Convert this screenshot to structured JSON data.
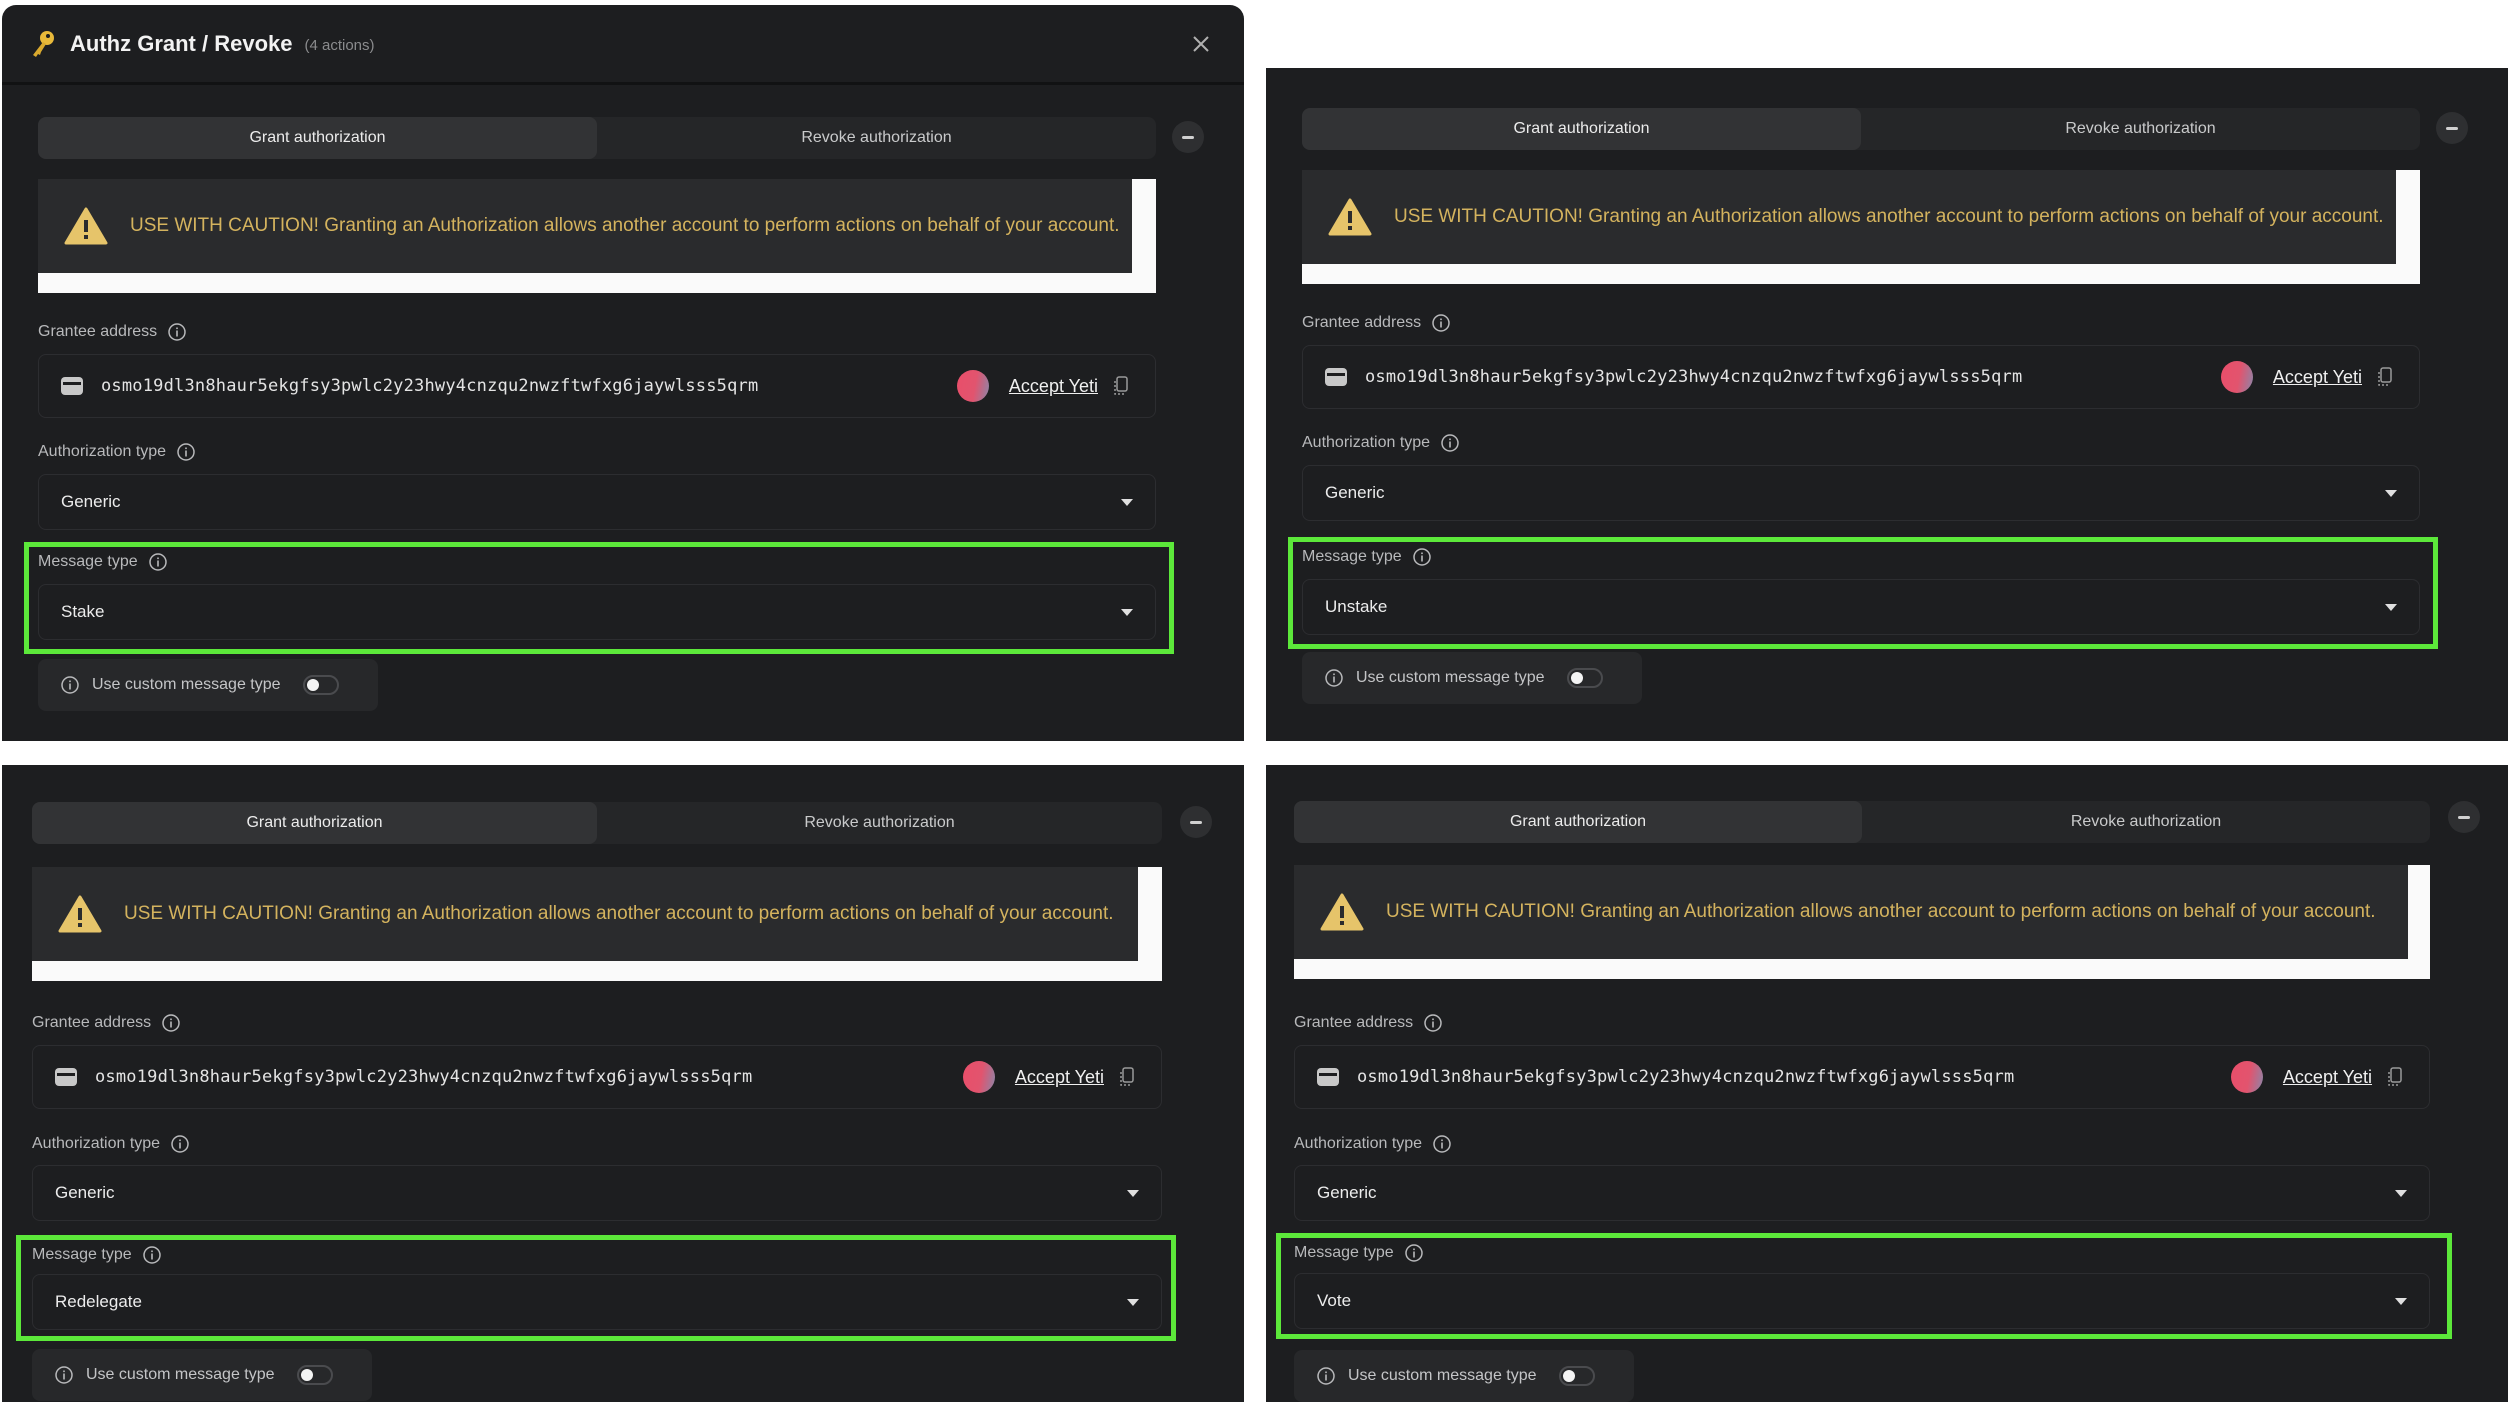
{
  "header": {
    "icon": "key-icon",
    "title": "Authz Grant / Revoke",
    "subtitle": "(4 actions)",
    "close_icon": "close-icon"
  },
  "common": {
    "tabs": [
      {
        "label": "Grant authorization",
        "active": true
      },
      {
        "label": "Revoke authorization",
        "active": false
      }
    ],
    "remove_icon": "minus-icon",
    "caution_text": "USE WITH CAUTION! Granting an Authorization allows another account to perform actions on behalf of your account.",
    "grantee_label": "Grantee address",
    "grantee_address": "osmo19dl3n8haur5ekgfsy3pwlc2y23hwy4cnzqu2nwzftwfxg6jaywlsss5qrm",
    "grantee_name": "Accept Yeti",
    "auth_type_label": "Authorization type",
    "auth_type_value": "Generic",
    "message_type_label": "Message type",
    "custom_toggle_label": "Use custom message type",
    "custom_toggle_on": false
  },
  "actions": [
    {
      "message_type": "Stake"
    },
    {
      "message_type": "Unstake"
    },
    {
      "message_type": "Redelegate"
    },
    {
      "message_type": "Vote"
    }
  ],
  "colors": {
    "background": "#1d1e20",
    "caution_text": "#d4b35e",
    "highlight": "#5ce83a"
  }
}
